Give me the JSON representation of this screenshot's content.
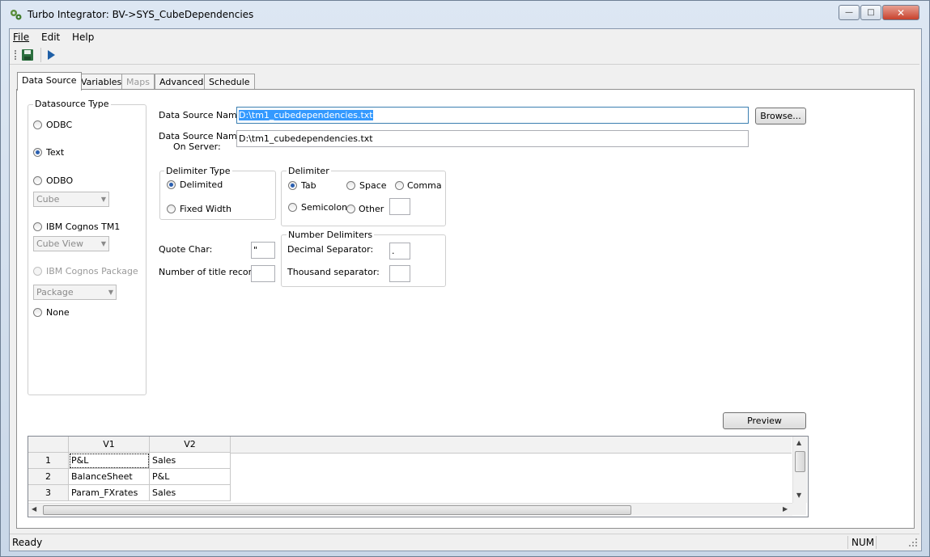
{
  "window": {
    "title": "Turbo Integrator:  BV->SYS_CubeDependencies",
    "minimize_label": "—",
    "maximize_label": "□",
    "close_label": "✕"
  },
  "menu": {
    "file": "File",
    "edit": "Edit",
    "help": "Help"
  },
  "toolbar": {
    "save_icon": "save-icon",
    "run_icon": "run-icon"
  },
  "tabs": [
    {
      "label": "Data Source",
      "state": "active"
    },
    {
      "label": "Variables",
      "state": "normal"
    },
    {
      "label": "Maps",
      "state": "disabled"
    },
    {
      "label": "Advanced",
      "state": "normal"
    },
    {
      "label": "Schedule",
      "state": "normal"
    }
  ],
  "datasource_type": {
    "legend": "Datasource Type",
    "options": {
      "odbc": "ODBC",
      "text": "Text",
      "odbo": "ODBO",
      "tm1": "IBM Cognos TM1",
      "package": "IBM Cognos Package",
      "none": "None"
    },
    "selected": "Text",
    "odbo_combo": "Cube",
    "tm1_combo": "Cube View",
    "package_combo": "Package"
  },
  "source": {
    "name_label": "Data Source Name:",
    "name_value": "D:\\tm1_cubedependencies.txt",
    "server_label_line1": "Data Source Name",
    "server_label_line2": "On Server:",
    "server_value": "D:\\tm1_cubedependencies.txt",
    "browse_label": "Browse..."
  },
  "delimiter_type": {
    "legend": "Delimiter Type",
    "delimited": "Delimited",
    "fixed_width": "Fixed Width",
    "selected": "Delimited"
  },
  "delimiter": {
    "legend": "Delimiter",
    "tab": "Tab",
    "space": "Space",
    "comma": "Comma",
    "semicolon": "Semicolon",
    "other": "Other",
    "selected": "Tab",
    "other_value": ""
  },
  "quote": {
    "label": "Quote Char:",
    "value": "\"",
    "title_records_label": "Number of title records:",
    "title_records_value": ""
  },
  "number_delimiters": {
    "legend": "Number Delimiters",
    "decimal_label": "Decimal Separator:",
    "decimal_value": ".",
    "thousand_label": "Thousand separator:",
    "thousand_value": ""
  },
  "preview": {
    "button_label": "Preview",
    "columns": [
      "V1",
      "V2"
    ],
    "rows": [
      {
        "num": "1",
        "v1": "P&L",
        "v2": "Sales"
      },
      {
        "num": "2",
        "v1": "BalanceSheet",
        "v2": "P&L"
      },
      {
        "num": "3",
        "v1": "Param_FXrates",
        "v2": "Sales"
      }
    ]
  },
  "status": {
    "text": "Ready",
    "num": "NUM"
  }
}
